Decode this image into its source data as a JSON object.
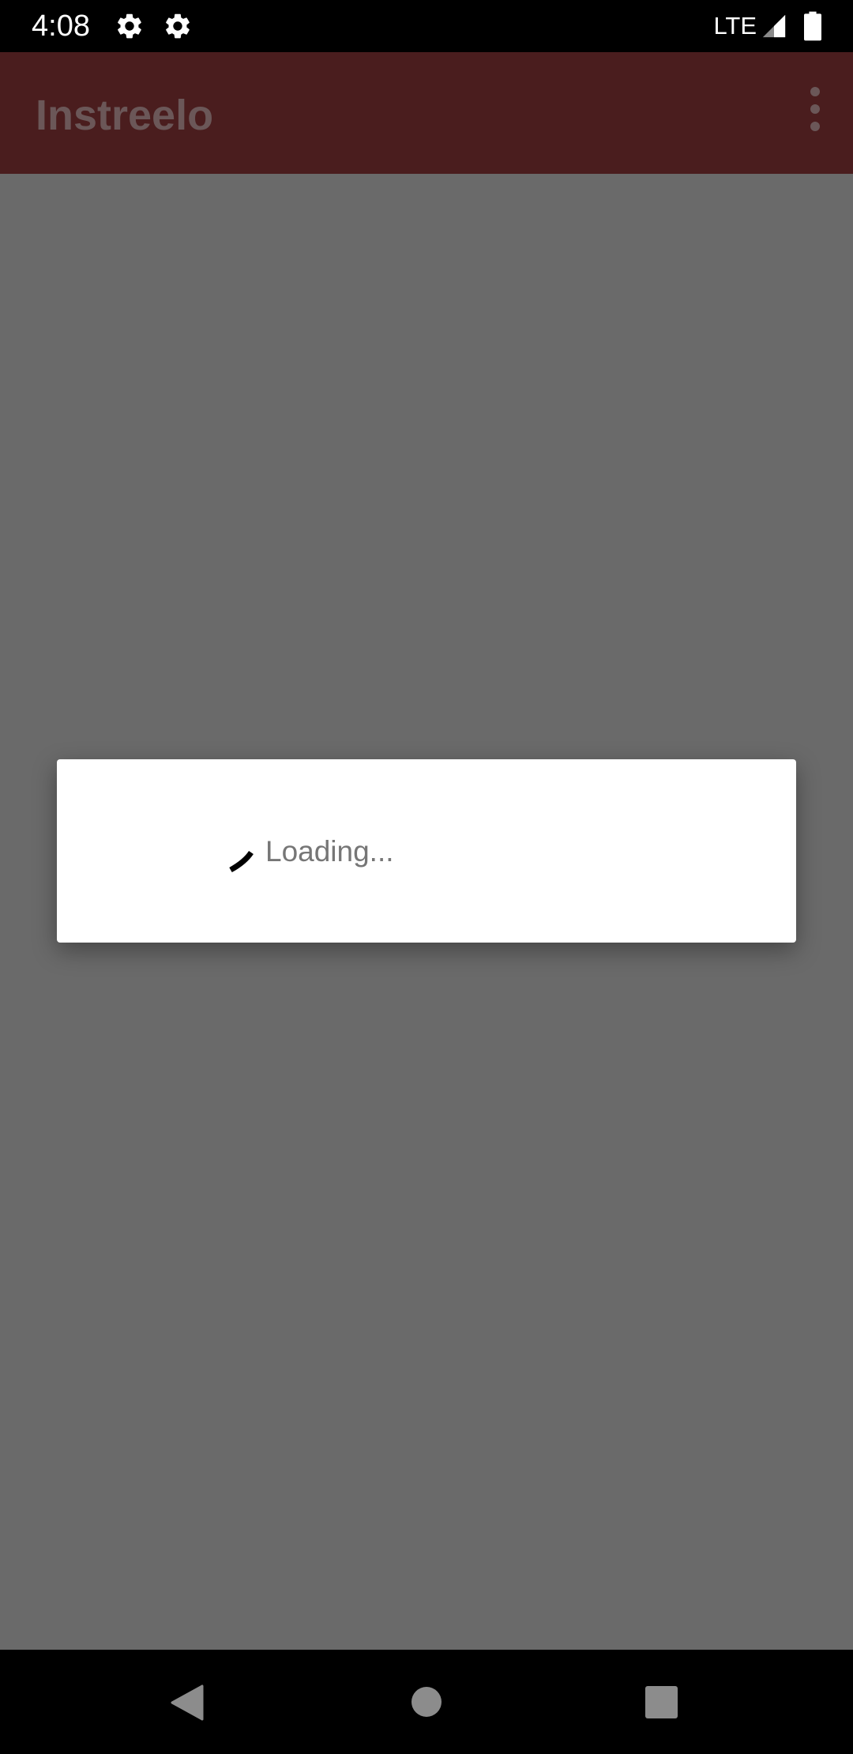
{
  "status_bar": {
    "time": "4:08",
    "network": "LTE",
    "icons": [
      "settings-icon",
      "settings-icon",
      "signal-icon",
      "battery-icon"
    ]
  },
  "app_bar": {
    "title": "Instreelo",
    "overflow_icon": "more-vert-icon",
    "color": "#4a1d1e"
  },
  "dialog": {
    "message": "Loading...",
    "indicator": "spinner-icon"
  },
  "nav_bar": {
    "icons": [
      "back-icon",
      "home-icon",
      "recents-icon"
    ]
  },
  "colors": {
    "scrim": "#6a6a6a",
    "status_bar": "#000000",
    "dialog": "#ffffff"
  }
}
